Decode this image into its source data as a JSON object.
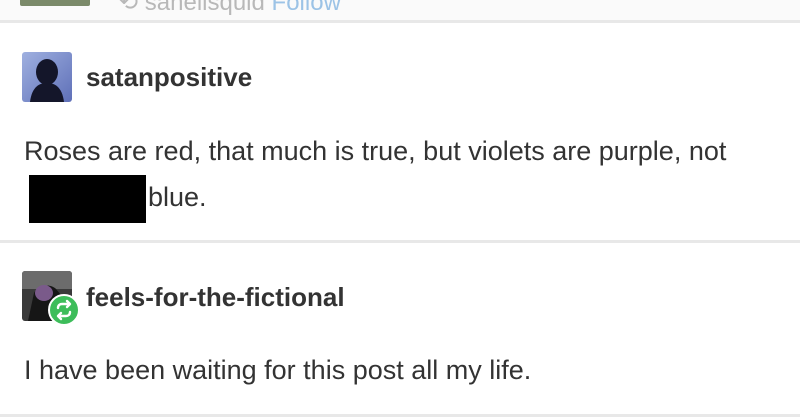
{
  "header": {
    "reblogged_from": "sahelisquid",
    "follow_label": "Follow"
  },
  "posts": [
    {
      "username": "satanpositive",
      "text_before_redaction": "Roses are red, that much is true, but violets are purple, not",
      "text_after_redaction": "blue."
    },
    {
      "username": "feels-for-the-fictional",
      "text": "I have been waiting for this post all my life."
    }
  ],
  "colors": {
    "username": "#333333",
    "body_text": "#333333",
    "divider": "#e8e8e8",
    "reblog_badge": "#3dbd5a",
    "follow_link": "#9cc3e6"
  },
  "icons": {
    "avatar_1": "silhouette-avatar-icon",
    "avatar_2": "dark-figure-avatar-icon",
    "reblog_badge": "reblog-icon"
  }
}
